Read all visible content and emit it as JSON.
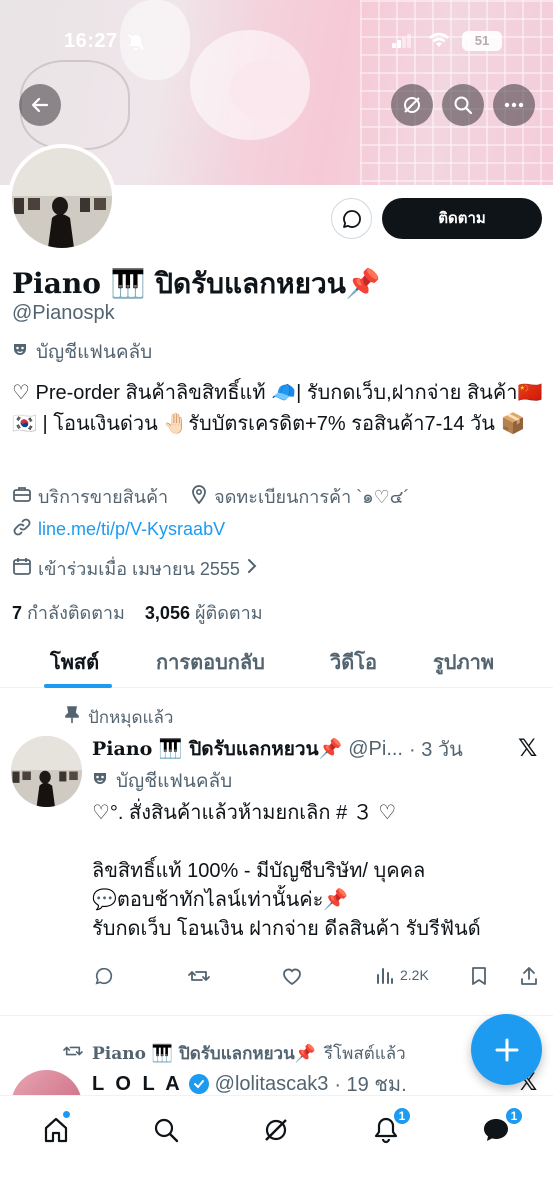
{
  "status_bar": {
    "time": "16:27",
    "battery": "51"
  },
  "header": {
    "follow_label": "ติดตาม"
  },
  "profile": {
    "name": "Piano 🎹 ปิดรับแลกหยวน📌",
    "handle": "@Pianospk",
    "fan_label": "บัญชีแฟนคลับ",
    "bio": "♡ Pre-order สินค้าลิขสิทธิ์แท้ 🧢| รับกดเว็บ,ฝากจ่าย สินค้า🇨🇳🇰🇷 | โอนเงินด่วน 🤚🏻รับบัตรเครดิต+7% รอสินค้า7-14 วัน 📦",
    "category": "บริการขายสินค้า",
    "location": "จดทะเบียนการค้า `๑♡๔´",
    "link": "line.me/ti/p/V-KysraabV",
    "joined": "เข้าร่วมเมื่อ เมษายน 2555",
    "following_count": "7",
    "following_label": "กำลังติดตาม",
    "followers_count": "3,056",
    "followers_label": "ผู้ติดตาม"
  },
  "tabs": [
    {
      "label": "โพสต์"
    },
    {
      "label": "การตอบกลับ"
    },
    {
      "label": "วิดีโอ"
    },
    {
      "label": "รูปภาพ"
    }
  ],
  "post1": {
    "pinned_label": "ปักหมุดแล้ว",
    "name": "Piano 🎹 ปิดรับแลกหยวน📌",
    "handle": "@Pi...",
    "time": "· 3 วัน",
    "fan_label": "บัญชีแฟนคลับ",
    "text": "♡°.  สั่งสินค้าแล้วห้ามยกเลิก # ３   ♡\n\nลิขสิทธิ์แท้ 100% - มีบัญชีบริษัท/ บุคคล\n💬ตอบช้าทักไลน์เท่านั้นค่ะ📌\nรับกดเว็บ  โอนเงิน ฝากจ่าย ดีลสินค้า รับรีฟันด์",
    "views": "2.2K"
  },
  "post2": {
    "repost_name": "Piano 🎹 ปิดรับแลกหยวน📌",
    "repost_label": "รีโพสต์แล้ว",
    "name": "L O L A",
    "handle": "@lolitascak3",
    "time": "· 19 ชม."
  },
  "bottom_nav": {
    "notifications_badge": "1",
    "messages_badge": "1"
  },
  "colors": {
    "accent": "#1d9bf0",
    "text": "#0f1419",
    "muted": "#536471"
  }
}
